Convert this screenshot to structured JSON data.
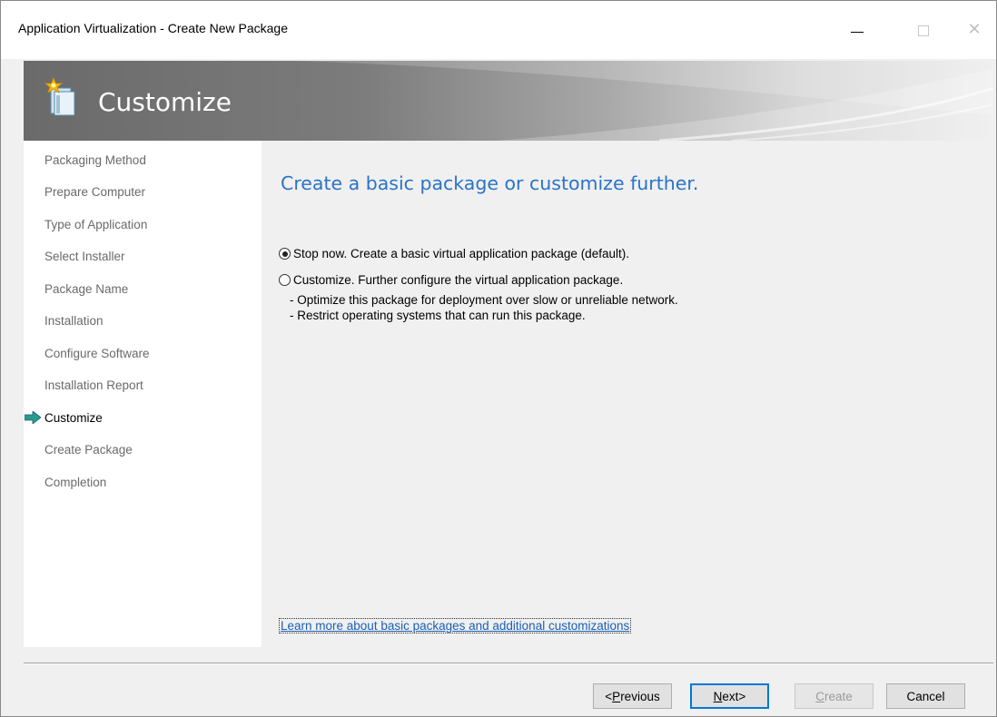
{
  "window": {
    "title": "Application Virtualization - Create New Package"
  },
  "banner": {
    "title": "Customize",
    "icon": "wizard-star-icon"
  },
  "nav": {
    "items": [
      {
        "label": "Packaging Method",
        "active": false
      },
      {
        "label": "Prepare Computer",
        "active": false
      },
      {
        "label": "Type of Application",
        "active": false
      },
      {
        "label": "Select Installer",
        "active": false
      },
      {
        "label": "Package Name",
        "active": false
      },
      {
        "label": "Installation",
        "active": false
      },
      {
        "label": "Configure Software",
        "active": false
      },
      {
        "label": "Installation Report",
        "active": false
      },
      {
        "label": "Customize",
        "active": true
      },
      {
        "label": "Create Package",
        "active": false
      },
      {
        "label": "Completion",
        "active": false
      }
    ]
  },
  "main": {
    "heading": "Create a basic package or customize further.",
    "options": [
      {
        "label": "Stop now.  Create a basic virtual application package (default).",
        "checked": true
      },
      {
        "label": "Customize.  Further configure the virtual application package.",
        "checked": false
      }
    ],
    "details": [
      "- Optimize this package for deployment over slow or unreliable network.",
      "- Restrict operating systems that can run this package."
    ],
    "learn_more": "Learn more about basic packages and additional customizations"
  },
  "buttons": {
    "previous": {
      "prefix": "<",
      "accel": "P",
      "rest": "revious"
    },
    "next": {
      "accel": "N",
      "rest": "ext>"
    },
    "create": {
      "accel": "C",
      "rest": "reate"
    },
    "cancel": "Cancel"
  },
  "colors": {
    "heading": "#2a73c8",
    "link": "#1a5fb4",
    "nav_inactive": "#6a6a6a",
    "focus_border": "#0078d7"
  }
}
